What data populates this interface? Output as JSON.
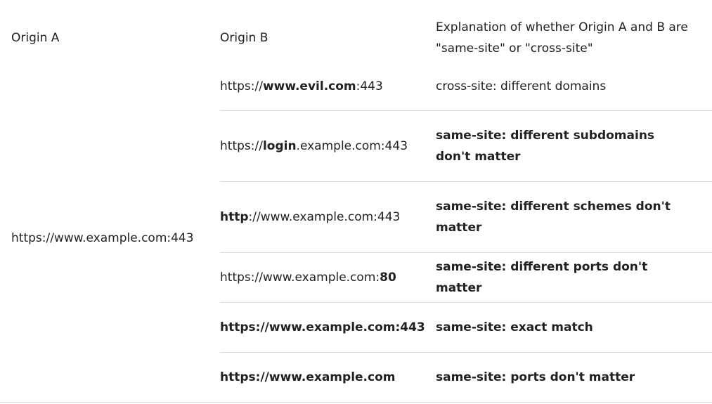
{
  "table": {
    "headers": {
      "origin_a": "Origin A",
      "origin_b": "Origin B",
      "explanation": "Explanation of whether Origin A and B are \"same-site\" or \"cross-site\""
    },
    "origin_a_value": "https://www.example.com:443",
    "rows": [
      {
        "origin_b": [
          {
            "text": "https://",
            "bold": false
          },
          {
            "text": "www.evil.com",
            "bold": true
          },
          {
            "text": ":443",
            "bold": false
          }
        ],
        "explanation": "cross-site: different domains",
        "explanation_bold": false
      },
      {
        "origin_b": [
          {
            "text": "https://",
            "bold": false
          },
          {
            "text": "login",
            "bold": true
          },
          {
            "text": ".example.com:443",
            "bold": false
          }
        ],
        "explanation": "same-site: different subdomains don't matter",
        "explanation_bold": true
      },
      {
        "origin_b": [
          {
            "text": "http",
            "bold": true
          },
          {
            "text": "://www.example.com:443",
            "bold": false
          }
        ],
        "explanation": "same-site: different schemes don't matter",
        "explanation_bold": true
      },
      {
        "origin_b": [
          {
            "text": "https://www.example.com:",
            "bold": false
          },
          {
            "text": "80",
            "bold": true
          }
        ],
        "explanation": "same-site: different ports don't matter",
        "explanation_bold": true
      },
      {
        "origin_b": [
          {
            "text": "https://www.example.com:443",
            "bold": true
          }
        ],
        "explanation": "same-site: exact match",
        "explanation_bold": true
      },
      {
        "origin_b": [
          {
            "text": "https://www.example.com",
            "bold": true
          }
        ],
        "explanation": "same-site: ports don't matter",
        "explanation_bold": true
      }
    ]
  }
}
